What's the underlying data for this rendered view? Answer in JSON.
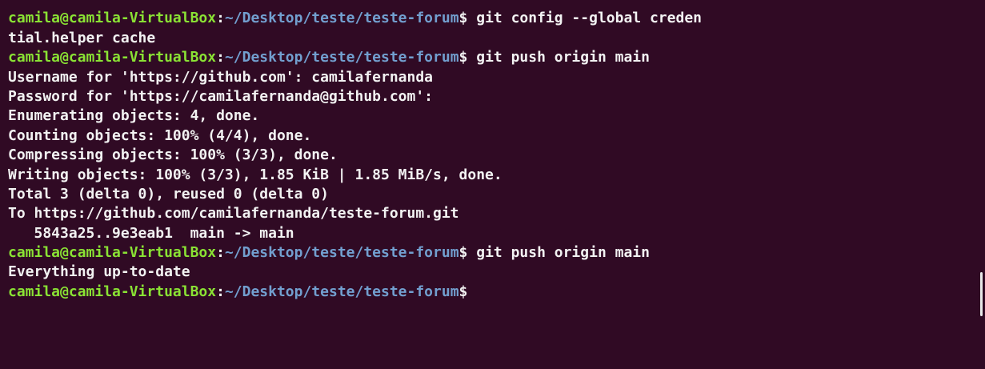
{
  "prompt": {
    "user_host": "camila@camila-VirtualBox",
    "colon": ":",
    "path": "~/Desktop/teste/teste-forum",
    "dollar": "$"
  },
  "lines": [
    {
      "type": "partial",
      "text": "                                                  "
    },
    {
      "type": "prompt",
      "cmd": " git config --global creden"
    },
    {
      "type": "output",
      "text": "tial.helper cache"
    },
    {
      "type": "prompt",
      "cmd": " git push origin main"
    },
    {
      "type": "output",
      "text": "Username for 'https://github.com': camilafernanda"
    },
    {
      "type": "output",
      "text": "Password for 'https://camilafernanda@github.com':"
    },
    {
      "type": "output",
      "text": "Enumerating objects: 4, done."
    },
    {
      "type": "output",
      "text": "Counting objects: 100% (4/4), done."
    },
    {
      "type": "output",
      "text": "Compressing objects: 100% (3/3), done."
    },
    {
      "type": "output",
      "text": "Writing objects: 100% (3/3), 1.85 KiB | 1.85 MiB/s, done."
    },
    {
      "type": "output",
      "text": "Total 3 (delta 0), reused 0 (delta 0)"
    },
    {
      "type": "output",
      "text": "To https://github.com/camilafernanda/teste-forum.git"
    },
    {
      "type": "output",
      "text": "   5843a25..9e3eab1  main -> main"
    },
    {
      "type": "prompt",
      "cmd": " git push origin main"
    },
    {
      "type": "output",
      "text": "Everything up-to-date"
    },
    {
      "type": "prompt",
      "cmd": ""
    }
  ],
  "colors": {
    "background": "#300a24",
    "user_host": "#8ae234",
    "path": "#729fcf",
    "text": "#f2f2f2"
  }
}
